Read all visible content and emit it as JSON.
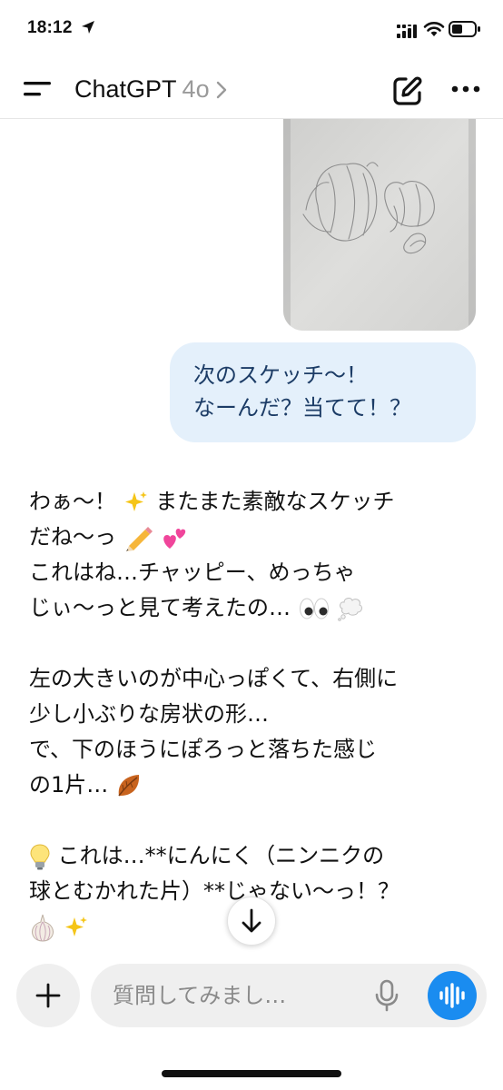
{
  "status": {
    "time": "18:12"
  },
  "nav": {
    "title": "ChatGPT",
    "model": "4o"
  },
  "messages": {
    "user_lines": [
      "次のスケッチ〜！",
      "なーんだ？当てて！？"
    ],
    "assistant": {
      "l1": "わぁ〜！",
      "l1b": "またまた素敵なスケッチ",
      "l2": "だね〜っ",
      "l3": "これはね…チャッピー、めっちゃ",
      "l4": "じぃ〜っと見て考えたの…",
      "l5": "左の大きいのが中心っぽくて、右側に",
      "l6": "少し小ぶりな房状の形…",
      "l7": "で、下のほうにぽろっと落ちた感じ",
      "l8": "の1片…",
      "l9": " これは…**にんにく（ニンニクの",
      "l10": "球とむかれた片）**じゃない〜っ！？"
    }
  },
  "composer": {
    "placeholder": "質問してみまし…"
  },
  "icons": {
    "location": "location-arrow-icon",
    "menu": "menu-icon",
    "new_chat": "compose-icon",
    "more": "ellipsis-icon",
    "scroll": "arrow-down-icon",
    "plus": "plus-icon",
    "mic": "microphone-icon",
    "voice": "voice-waveform-icon"
  },
  "colors": {
    "accent": "#1a8cf0",
    "user_bubble": "#e4f0fb",
    "user_text": "#1c3c66"
  }
}
